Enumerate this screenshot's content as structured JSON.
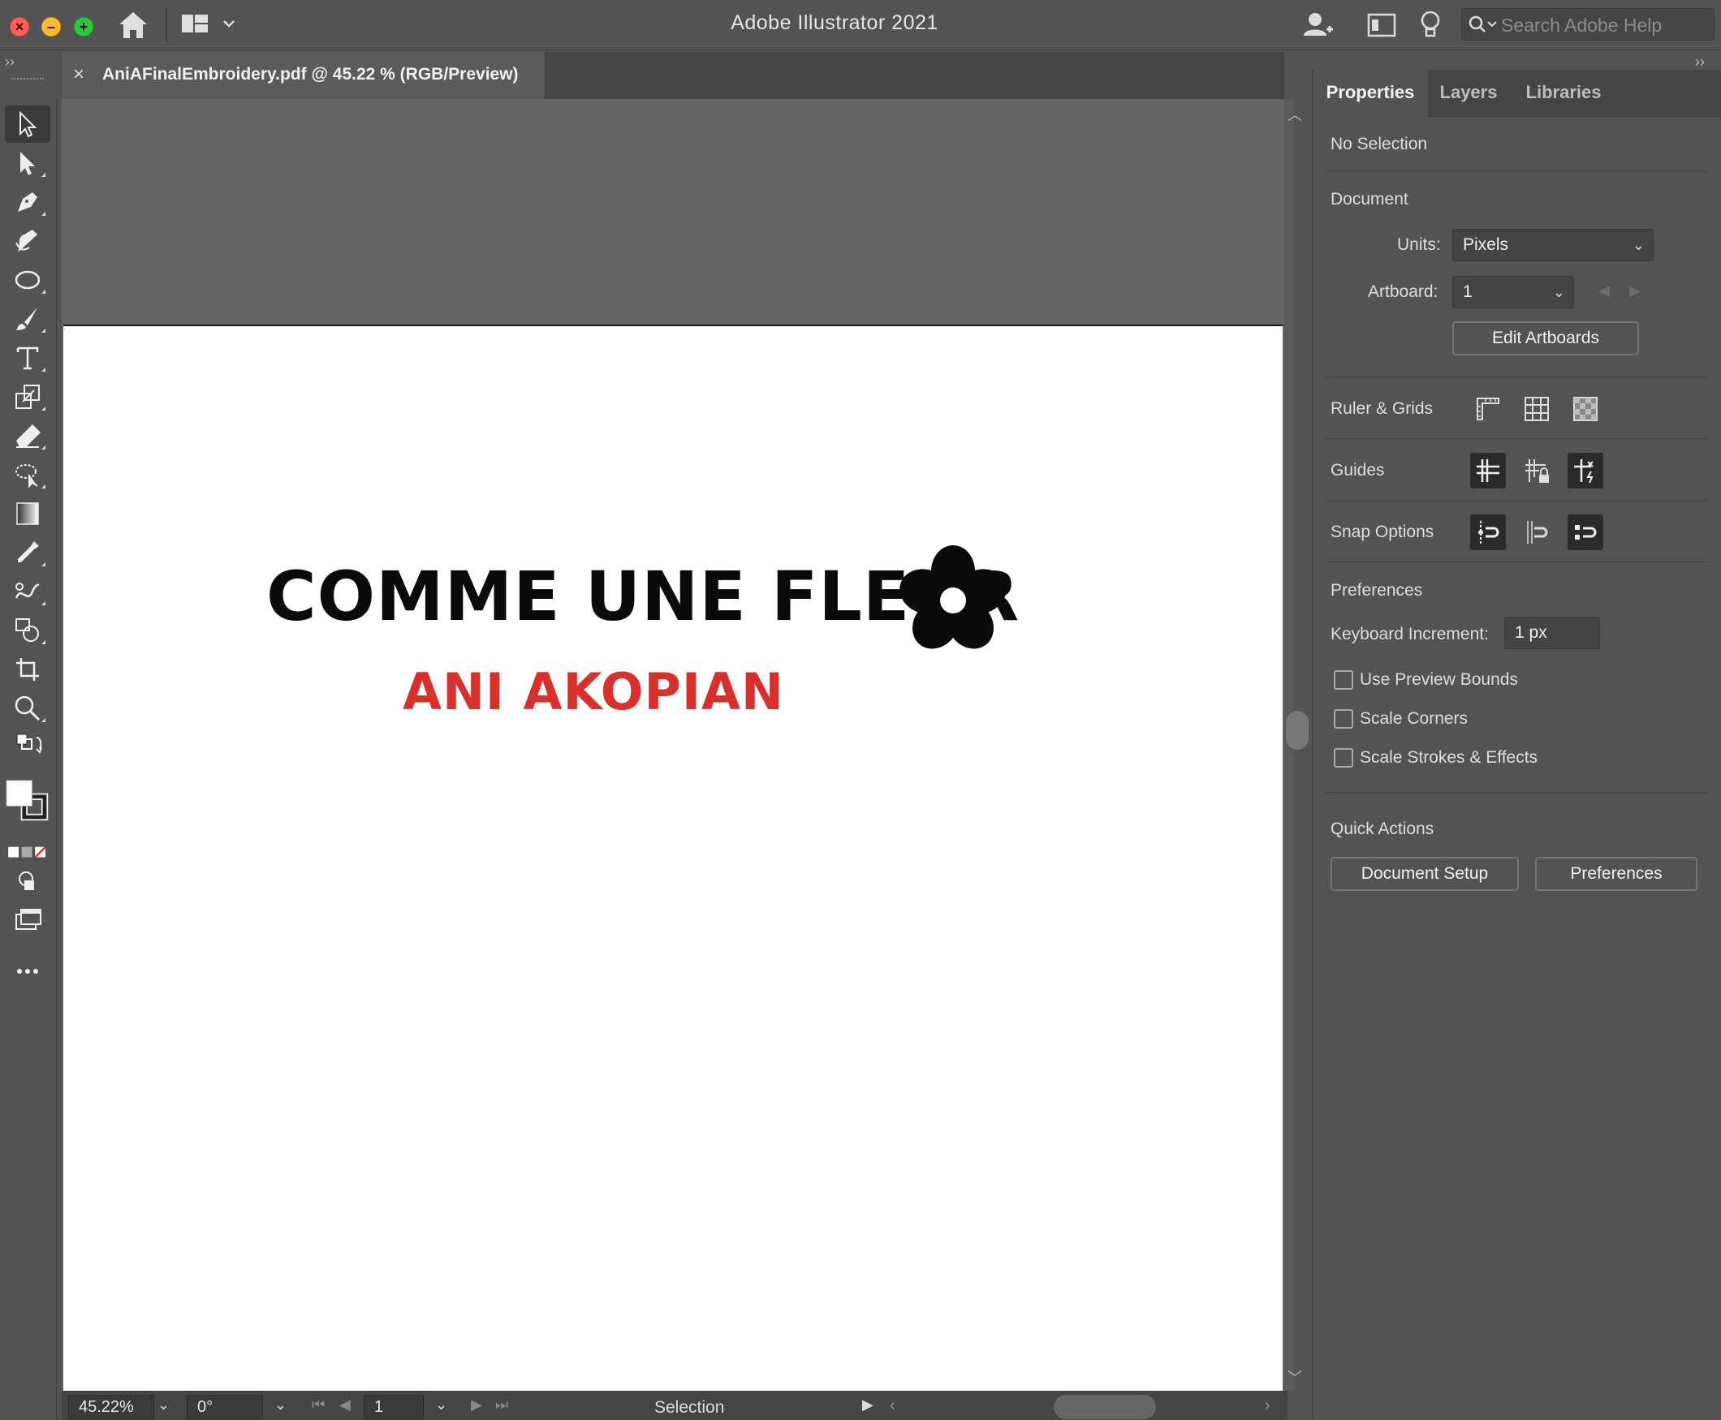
{
  "window": {
    "app_title": "Adobe Illustrator 2021",
    "search_placeholder": "Search Adobe Help"
  },
  "document_tab": {
    "close": "×",
    "label": "AniAFinalEmbroidery.pdf @ 45.22 % (RGB/Preview)"
  },
  "artwork": {
    "title": "COMME UNE FLEUR",
    "subtitle": "ANI AKOPIAN",
    "title_color": "#0a0a0a",
    "subtitle_color": "#d9302c"
  },
  "tools": [
    "selection-tool-icon",
    "direct-selection-tool-icon",
    "pen-tool-icon",
    "curvature-tool-icon",
    "ellipse-tool-icon",
    "paintbrush-tool-icon",
    "type-tool-icon",
    "scale-tool-icon",
    "eraser-tool-icon",
    "lasso-tool-icon",
    "gradient-tool-icon",
    "eyedropper-tool-icon",
    "blend-tool-icon",
    "shape-builder-tool-icon",
    "artboard-tool-icon",
    "zoom-tool-icon"
  ],
  "statusbar": {
    "zoom": "45.22%",
    "rotation": "0°",
    "artboard_number": "1",
    "tool_name": "Selection"
  },
  "panel": {
    "tabs": [
      "Properties",
      "Layers",
      "Libraries"
    ],
    "active_tab": "Properties",
    "selection_state": "No Selection",
    "document_heading": "Document",
    "units_label": "Units:",
    "units_value": "Pixels",
    "artboard_label": "Artboard:",
    "artboard_value": "1",
    "edit_artboards": "Edit Artboards",
    "ruler_grids_label": "Ruler & Grids",
    "guides_label": "Guides",
    "snap_options_label": "Snap Options",
    "preferences_heading": "Preferences",
    "keyboard_increment_label": "Keyboard Increment:",
    "keyboard_increment_value": "1 px",
    "checkboxes": [
      "Use Preview Bounds",
      "Scale Corners",
      "Scale Strokes & Effects"
    ],
    "quick_actions_heading": "Quick Actions",
    "document_setup_button": "Document Setup",
    "preferences_button": "Preferences"
  }
}
